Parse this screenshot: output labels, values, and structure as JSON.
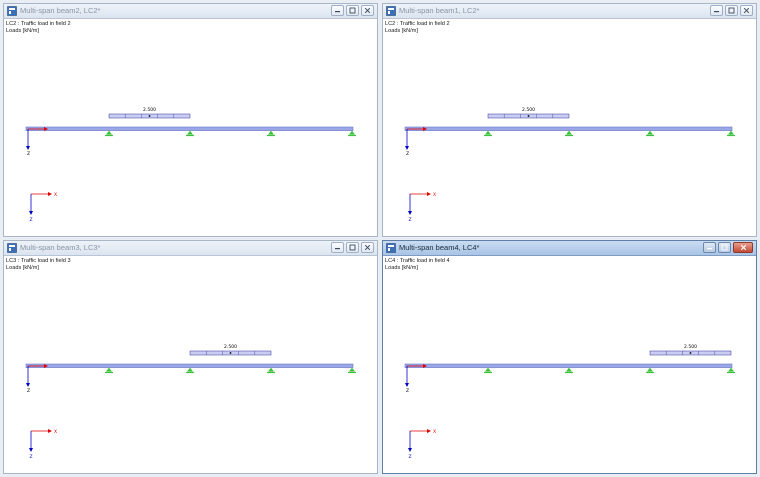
{
  "colors": {
    "beam_fill": "#9aa6e6",
    "beam_stroke": "#6c78c6",
    "support": "#3ec23e",
    "load_fill": "#c9cdf2",
    "load_stroke": "#333399",
    "axis_x": "#e00000",
    "axis_z": "#0000c0"
  },
  "icons": {
    "title": "rfem-window-icon",
    "minimize": "minimize-icon",
    "restore": "restore-icon",
    "close": "close-icon"
  },
  "windows": [
    {
      "title": "Multi-span beam2, LC2*",
      "lc_line": "LC2 : Traffic load in field 2",
      "units": "Loads [kN/m]",
      "load_value": "2.500",
      "load_field": 2,
      "active": false
    },
    {
      "title": "Multi-span beam1, LC2*",
      "lc_line": "LC2 : Traffic load in field 2",
      "units": "Loads [kN/m]",
      "load_value": "2.500",
      "load_field": 2,
      "active": false
    },
    {
      "title": "Multi-span beam3, LC3*",
      "lc_line": "LC3 : Traffic load in field 3",
      "units": "Loads [kN/m]",
      "load_value": "2.500",
      "load_field": 3,
      "active": false
    },
    {
      "title": "Multi-span beam4, LC4*",
      "lc_line": "LC4 : Traffic load in field 4",
      "units": "Loads [kN/m]",
      "load_value": "2.500",
      "load_field": 4,
      "active": true
    }
  ],
  "axes": {
    "x_label": "X",
    "z_label": "Z"
  }
}
